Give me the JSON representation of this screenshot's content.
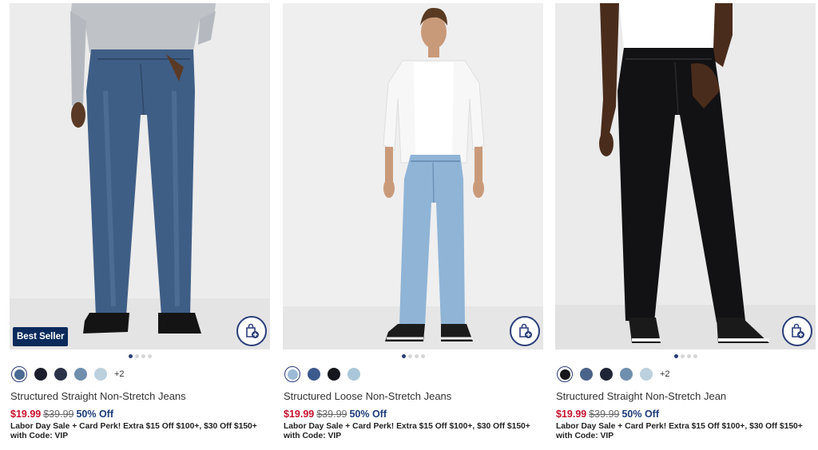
{
  "products": [
    {
      "badge": "Best Seller",
      "name": "Structured Straight Non-Stretch Jeans",
      "sale_price": "$19.99",
      "original_price": "$39.99",
      "discount": "50% Off",
      "promo": "Labor Day Sale + Card Perk! Extra $15 Off $100+, $30 Off $150+ with Code: VIP",
      "more_colors": "+2",
      "swatches": [
        "#4a6b92",
        "#1c1f2b",
        "#2a3347",
        "#6f8fad",
        "#bcd0de"
      ],
      "image_dots": 4
    },
    {
      "badge": "",
      "name": "Structured Loose Non-Stretch Jeans",
      "sale_price": "$19.99",
      "original_price": "$39.99",
      "discount": "50% Off",
      "promo": "Labor Day Sale + Card Perk! Extra $15 Off $100+, $30 Off $150+ with Code: VIP",
      "more_colors": "",
      "swatches": [
        "#9dbbd6",
        "#3c5a8c",
        "#15171c",
        "#a9c7d8"
      ],
      "image_dots": 4
    },
    {
      "badge": "",
      "name": "Structured Straight Non-Stretch Jean",
      "sale_price": "$19.99",
      "original_price": "$39.99",
      "discount": "50% Off",
      "promo": "Labor Day Sale + Card Perk! Extra $15 Off $100+, $30 Off $150+ with Code: VIP",
      "more_colors": "+2",
      "swatches": [
        "#16171b",
        "#4a6388",
        "#1f2535",
        "#6f8fad",
        "#bcd0de"
      ],
      "image_dots": 4
    }
  ],
  "icons": {
    "bag": "add-to-bag-icon"
  },
  "colors": {
    "accent": "#2b3d7a",
    "sale": "#c8102e",
    "discount": "#1d3b7a",
    "badge": "#0b2a5b"
  }
}
